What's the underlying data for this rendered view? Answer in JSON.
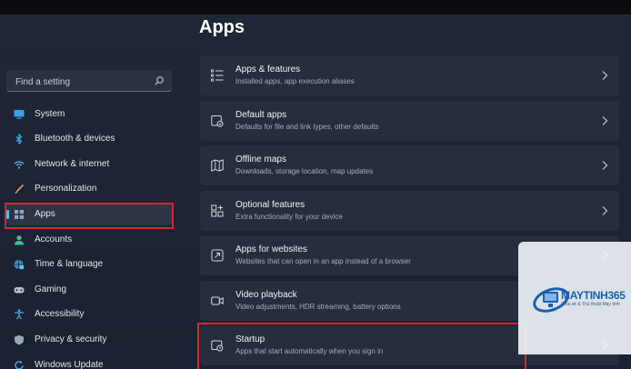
{
  "page": {
    "title": "Apps"
  },
  "search": {
    "placeholder": "Find a setting"
  },
  "sidebar": {
    "items": [
      {
        "label": "System",
        "icon": "monitor-icon"
      },
      {
        "label": "Bluetooth & devices",
        "icon": "bluetooth-icon"
      },
      {
        "label": "Network & internet",
        "icon": "wifi-icon"
      },
      {
        "label": "Personalization",
        "icon": "brush-icon"
      },
      {
        "label": "Apps",
        "icon": "apps-icon",
        "selected": true
      },
      {
        "label": "Accounts",
        "icon": "person-icon"
      },
      {
        "label": "Time & language",
        "icon": "globe-clock-icon"
      },
      {
        "label": "Gaming",
        "icon": "gamepad-icon"
      },
      {
        "label": "Accessibility",
        "icon": "accessibility-icon"
      },
      {
        "label": "Privacy & security",
        "icon": "shield-icon"
      },
      {
        "label": "Windows Update",
        "icon": "update-icon"
      }
    ]
  },
  "cards": [
    {
      "title": "Apps & features",
      "subtitle": "Installed apps, app execution aliases",
      "icon": "list-icon"
    },
    {
      "title": "Default apps",
      "subtitle": "Defaults for file and link types, other defaults",
      "icon": "default-apps-icon"
    },
    {
      "title": "Offline maps",
      "subtitle": "Downloads, storage location, map updates",
      "icon": "map-icon"
    },
    {
      "title": "Optional features",
      "subtitle": "Extra functionality for your device",
      "icon": "add-feature-icon"
    },
    {
      "title": "Apps for websites",
      "subtitle": "Websites that can open in an app instead of a browser",
      "icon": "open-link-icon"
    },
    {
      "title": "Video playback",
      "subtitle": "Video adjustments, HDR streaming, battery options",
      "icon": "video-icon"
    },
    {
      "title": "Startup",
      "subtitle": "Apps that start automatically when you sign in",
      "icon": "startup-icon"
    }
  ],
  "watermark": {
    "brand": "MAYTINH365",
    "tagline": "Chia sẻ & Thủ thuật Máy tính"
  },
  "colors": {
    "accent": "#4cc2ff",
    "highlight": "#d12a2f",
    "card": "#262d3d",
    "background": "#1c2332"
  }
}
